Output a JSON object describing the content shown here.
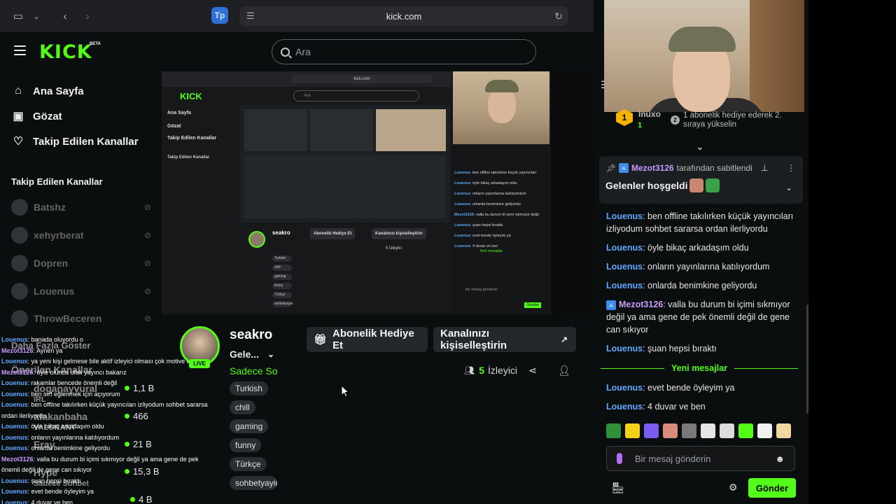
{
  "browser": {
    "url": "kick.com",
    "tp_label": "Tp"
  },
  "header": {
    "logo": "KICK",
    "logo_badge": "BETA",
    "search_placeholder": "Ara"
  },
  "sidebar": {
    "nav": [
      {
        "label": "Ana Sayfa",
        "icon": "home-icon"
      },
      {
        "label": "Gözat",
        "icon": "browse-icon"
      },
      {
        "label": "Takip Edilen Kanallar",
        "icon": "heart-icon"
      }
    ],
    "followed_title": "Takip Edilen Kanallar",
    "followed": [
      {
        "name": "Batshz"
      },
      {
        "name": "xehyrberat"
      },
      {
        "name": "Dopren"
      },
      {
        "name": "Louenus"
      },
      {
        "name": "ThrowBeceren"
      }
    ],
    "show_more": "Daha Fazla Göster",
    "recommended_title": "Önerilen Kanallar",
    "recommended": [
      {
        "name": "doganayvural",
        "viewers": "1,1 B"
      },
      {
        "name": "atakanbaha",
        "viewers": "466"
      },
      {
        "name": "Eray",
        "viewers": "21 B"
      },
      {
        "name": "Hype",
        "viewers": "15,3 B"
      },
      {
        "name": "",
        "viewers": "4 B"
      }
    ],
    "ghost_texts": [
      "IRL",
      "VALORANT",
      "Sadece Sohbet"
    ]
  },
  "overlay_chat": [
    {
      "user": "Louenus",
      "text": ": banada oluyordu o",
      "mod": false
    },
    {
      "user": "Mezot3126",
      "text": ": Aynen ya",
      "mod": true
    },
    {
      "user": "Louenus",
      "text": ": ya yeni kişi gelmese bile aktif izleyici olması çok motive ediyor",
      "mod": false
    },
    {
      "user": "Mezot3126",
      "text": ": öyle olunca ufak yayıncı bakarız",
      "mod": true
    },
    {
      "user": "Louenus",
      "text": ": rakamlar bencede önemli değil",
      "mod": false
    },
    {
      "user": "Louenus",
      "text": ": ben sırf eğlenmek için açıyorum",
      "mod": false
    },
    {
      "user": "Louenus",
      "text": ": ben offline takılırken küçük yayıncıları izliyodum sohbet sararsa ordan ilerliyordu",
      "mod": false
    },
    {
      "user": "Louenus",
      "text": ": öyle bikaç arkadaşım oldu",
      "mod": false
    },
    {
      "user": "Louenus",
      "text": ": onların yayınlarına katılıyordum",
      "mod": false
    },
    {
      "user": "Louenus",
      "text": ": onlarda benimkine geliyordu",
      "mod": false
    },
    {
      "user": "Mezot3126",
      "text": ": valla bu durum bi içimi sıkmıyor değil ya ama gene de pek önemli değil de gene can sıkıyor",
      "mod": true
    },
    {
      "user": "Louenus",
      "text": ": şuan hepsi bıraktı",
      "mod": false
    },
    {
      "user": "Louenus",
      "text": ": evet bende öyleyim ya",
      "mod": false
    },
    {
      "user": "Louenus",
      "text": ": 4 duvar ve ben",
      "mod": false
    }
  ],
  "video_preview": {
    "url": "kick.com",
    "search": "Ara",
    "side_items": [
      "Ana Sayfa",
      "Gözat",
      "Takip Edilen Kanallar"
    ],
    "followed_title": "Takip Edilen Kanallar",
    "channel": "seakro",
    "btn_gift": "Abonelik Hediye Et",
    "btn_customize": "Kanalınızı kişiselleştirin",
    "viewers": "5 İzleyici",
    "tags": [
      "Turkish",
      "chill",
      "gaming",
      "funny",
      "Türkçe",
      "sohbetyayin"
    ],
    "new_msgs": "Yeni mesajlar",
    "input": "Bir mesaj gönderin",
    "send": "Gönder",
    "chat_lines": [
      {
        "user": "Louenus",
        "text": "ben offline takılırken küçük yayıncıları"
      },
      {
        "user": "Louenus",
        "text": "öyle bikaç arkadaşım oldu"
      },
      {
        "user": "Louenus",
        "text": "onların yayınlarına katılıyordum"
      },
      {
        "user": "Louenus",
        "text": "onlarda benimkine geliyordu"
      },
      {
        "user": "Mezot3126",
        "text": "valla bu durum bi içimi sıkmıyor değil"
      },
      {
        "user": "Louenus",
        "text": "şuan hepsi bıraktı"
      },
      {
        "user": "Louenus",
        "text": "evet bende öyleyim ya"
      },
      {
        "user": "Louenus",
        "text": "4 duvar ve ben"
      }
    ]
  },
  "channel": {
    "name": "seakro",
    "title": "Gele...",
    "category": "Sadece Sohbet",
    "live": "LIVE",
    "tags": [
      "Turkish",
      "chill",
      "gaming",
      "funny",
      "Türkçe",
      "sohbetyayin"
    ],
    "gift_button": "Abonelik Hediye Et",
    "customize_button": "Kanalınızı kişiselleştirin",
    "viewer_count": "5",
    "viewer_label": "İzleyici"
  },
  "chat": {
    "sub_rank": "1",
    "sub_user": "Inuxo",
    "sub_count": "1",
    "sub_rank2": "2",
    "sub_text": "1 abonelik hediye ederek 2. sıraya yükselin",
    "pinned": {
      "user": "Mezot3126",
      "by_text": "tarafından sabitlendi",
      "message": "Gelenler hoşgeldi"
    },
    "messages": [
      {
        "user": "Louenus",
        "text": ": ben offline takılırken küçük yayıncıları izliyodum sohbet sararsa ordan ilerliyordu",
        "mod": false
      },
      {
        "user": "Louenus",
        "text": ": öyle bikaç arkadaşım oldu",
        "mod": false
      },
      {
        "user": "Louenus",
        "text": ": onların yayınlarına katılıyordum",
        "mod": false
      },
      {
        "user": "Louenus",
        "text": ": onlarda benimkine geliyordu",
        "mod": false
      },
      {
        "user": "Mezot3126",
        "text": ": valla bu durum bi içimi sıkmıyor değil ya ama gene de pek önemli değil de gene can sıkıyor",
        "mod": true
      },
      {
        "user": "Louenus",
        "text": ": şuan hepsi bıraktı",
        "mod": false
      }
    ],
    "new_messages_label": "Yeni mesajlar",
    "new_messages": [
      {
        "user": "Louenus",
        "text": ": evet bende öyleyim ya"
      },
      {
        "user": "Louenus",
        "text": ": 4 duvar ve ben"
      }
    ],
    "emotes": [
      "#2f8f3a",
      "#f3d21c",
      "#7b5cf0",
      "#d98c7a",
      "#7a7a7a",
      "#e6e6e6",
      "#dcdcdc",
      "#53fc18",
      "#f0f0f0",
      "#f1d7a0"
    ],
    "input_placeholder": "Bir mesaj gönderin",
    "send_label": "Gönder"
  },
  "colors": {
    "accent": "#53fc18",
    "user": "#5fa8ff",
    "mod_user": "#c89bff",
    "background": "#0b0e0f"
  }
}
